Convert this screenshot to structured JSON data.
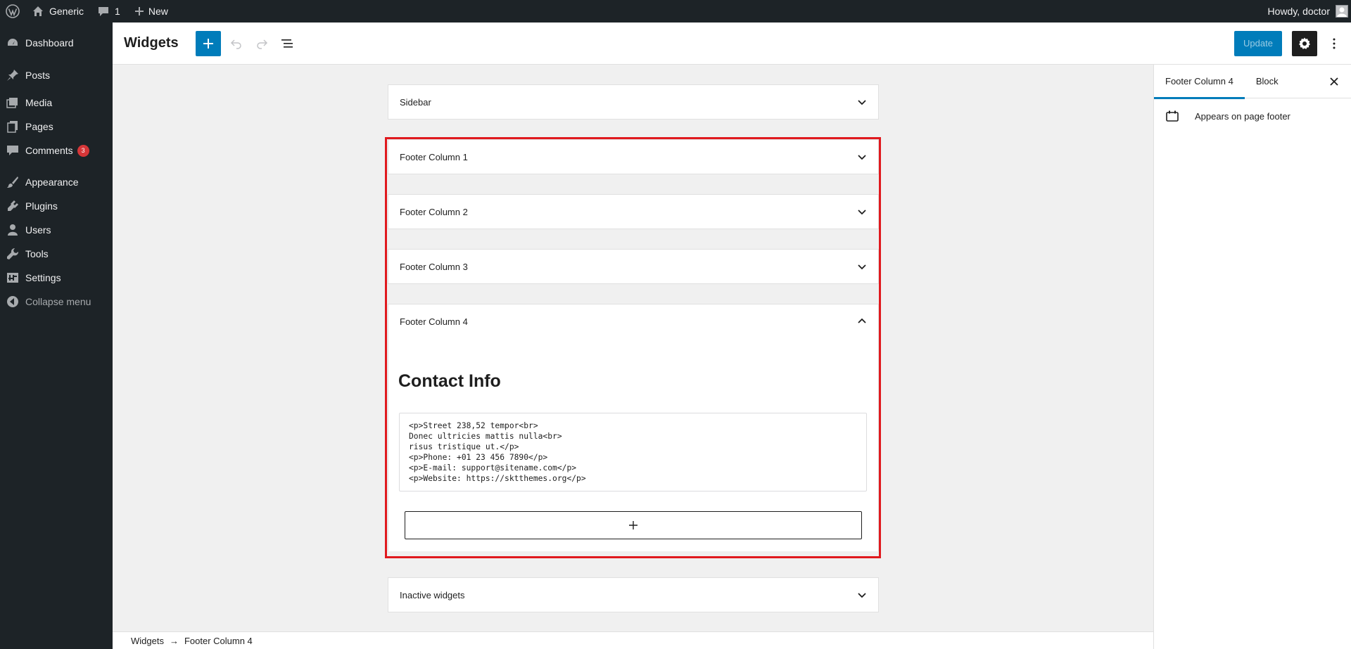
{
  "adminbar": {
    "site_name": "Generic",
    "comments_count": "1",
    "new_label": "New",
    "howdy": "Howdy, doctor"
  },
  "menu": {
    "items": [
      {
        "label": "Dashboard",
        "icon": "dashboard-icon"
      },
      {
        "label": "Posts",
        "icon": "pin-icon"
      },
      {
        "label": "Media",
        "icon": "media-icon"
      },
      {
        "label": "Pages",
        "icon": "pages-icon"
      },
      {
        "label": "Comments",
        "icon": "comment-icon",
        "badge": "3"
      },
      {
        "label": "Appearance",
        "icon": "brush-icon"
      },
      {
        "label": "Plugins",
        "icon": "plugin-icon"
      },
      {
        "label": "Users",
        "icon": "users-icon"
      },
      {
        "label": "Tools",
        "icon": "wrench-icon"
      },
      {
        "label": "Settings",
        "icon": "settings-icon"
      },
      {
        "label": "Collapse menu",
        "icon": "collapse-icon"
      }
    ]
  },
  "header": {
    "title": "Widgets",
    "update_label": "Update"
  },
  "areas": {
    "sidebar": "Sidebar",
    "footer1": "Footer Column 1",
    "footer2": "Footer Column 2",
    "footer3": "Footer Column 3",
    "footer4": "Footer Column 4",
    "inactive": "Inactive widgets"
  },
  "footer4_content": {
    "heading": "Contact Info",
    "html_code": "<p>Street 238,52 tempor<br>\nDonec ultricies mattis nulla<br>\nrisus tristique ut.</p>\n<p>Phone: +01 23 456 7890</p>\n<p>E-mail: support@sitename.com</p>\n<p>Website: https://sktthemes.org</p>"
  },
  "sidebar_panel": {
    "tab_area": "Footer Column 4",
    "tab_block": "Block",
    "description": "Appears on page footer"
  },
  "breadcrumb": {
    "root": "Widgets",
    "separator": "→",
    "current": "Footer Column 4"
  },
  "colors": {
    "accent": "#007cba",
    "highlight": "#e0191e",
    "admin_bg": "#1d2327",
    "badge": "#d63638"
  }
}
